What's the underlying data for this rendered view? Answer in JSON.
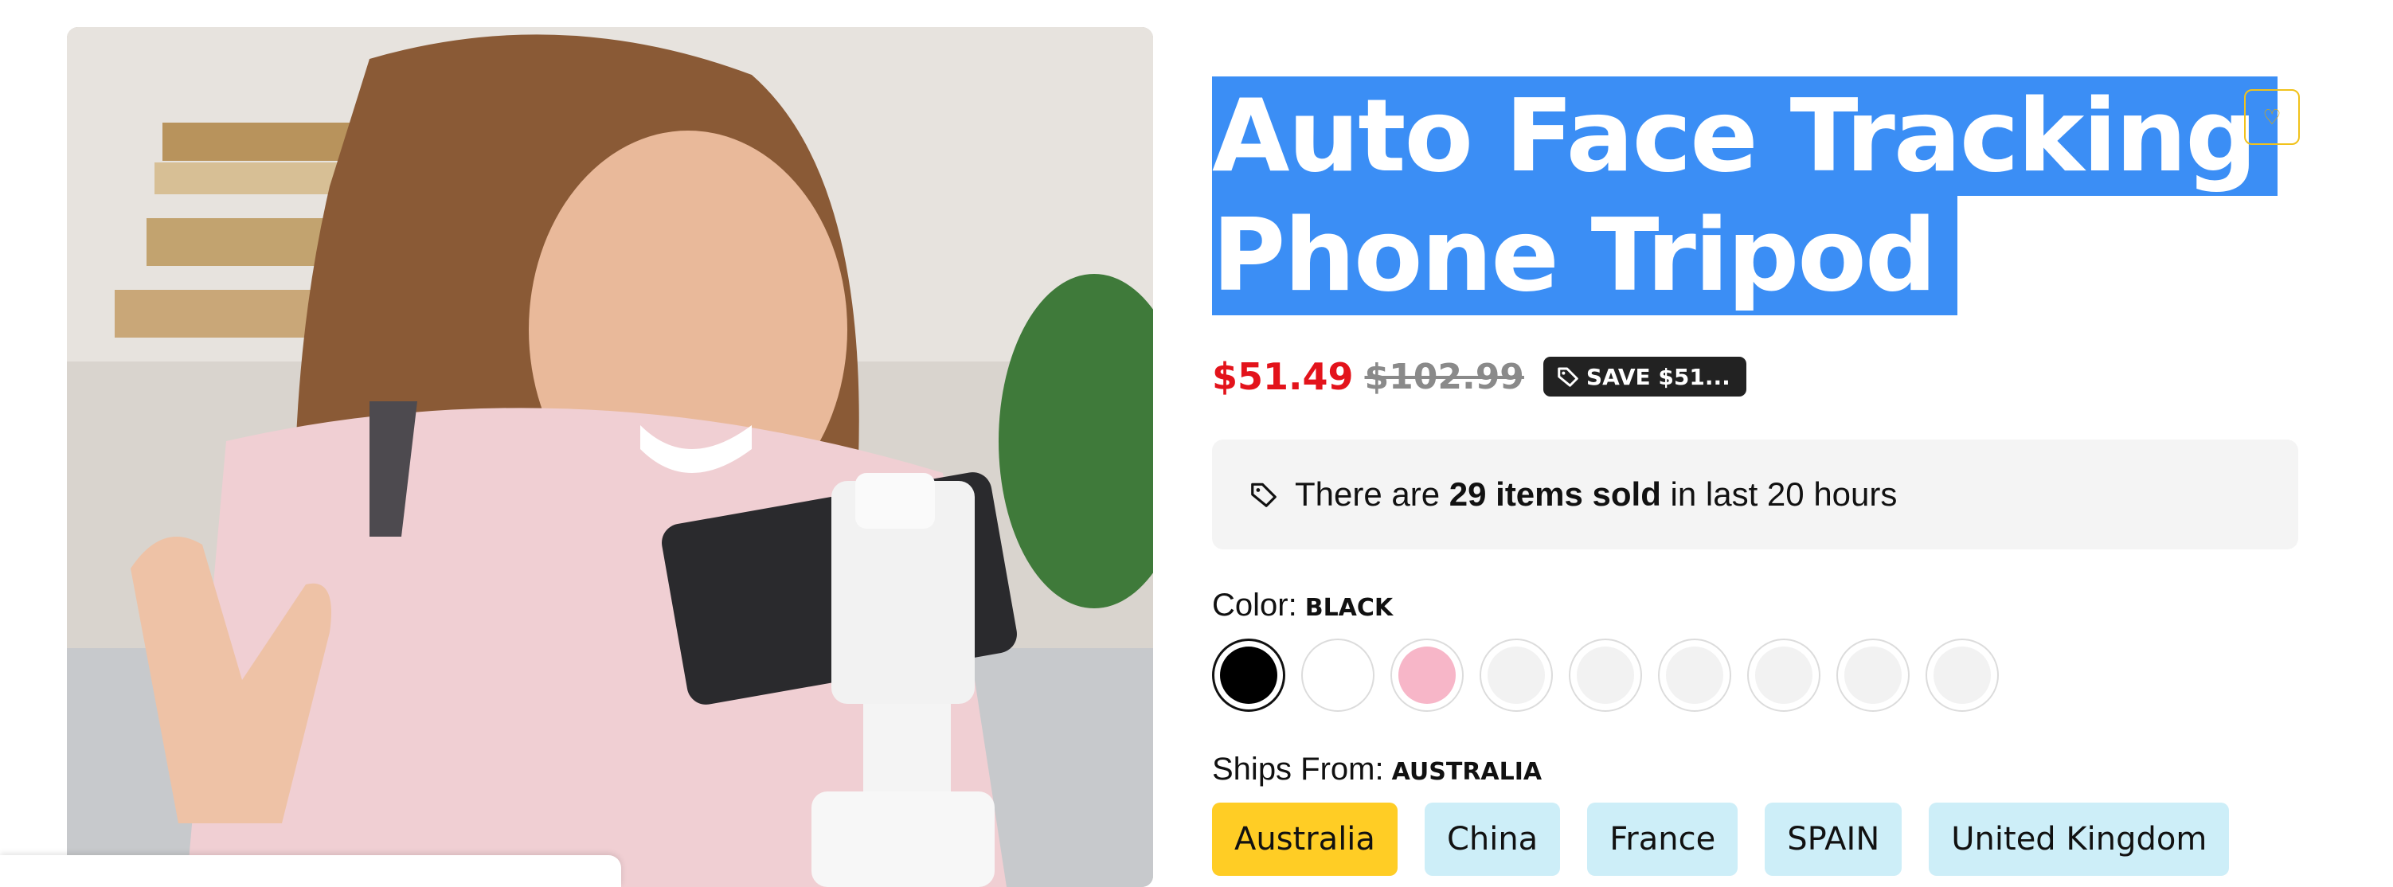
{
  "product": {
    "title_line1": "Auto Face Tracking",
    "title_line2": "Phone Tripod",
    "price_now": "$51.49",
    "price_old": "$102.99",
    "save_badge": "SAVE $51...",
    "image_icon": "product-photo-woman-with-phone-tripod"
  },
  "wishlist": {
    "icon": "heart-icon",
    "icon_glyph": "♡"
  },
  "sold": {
    "prefix": "There are",
    "count_text": "29 items sold",
    "suffix": "in last 20 hours"
  },
  "color": {
    "label": "Color:",
    "selected_value": "BLACK",
    "swatches": [
      {
        "color": "#000000",
        "selected": true
      },
      {
        "color": "#ffffff",
        "selected": false
      },
      {
        "color": "#f7b6c8",
        "selected": false
      },
      {
        "color": "#f2f2f2",
        "selected": false
      },
      {
        "color": "#f2f2f2",
        "selected": false
      },
      {
        "color": "#f2f2f2",
        "selected": false
      },
      {
        "color": "#f2f2f2",
        "selected": false
      },
      {
        "color": "#f2f2f2",
        "selected": false
      },
      {
        "color": "#f2f2f2",
        "selected": false
      }
    ]
  },
  "ships": {
    "label": "Ships From:",
    "selected_value": "AUSTRALIA",
    "options": [
      {
        "label": "Australia",
        "active": true
      },
      {
        "label": "China",
        "active": false
      },
      {
        "label": "France",
        "active": false
      },
      {
        "label": "SPAIN",
        "active": false
      },
      {
        "label": "United Kingdom",
        "active": false
      }
    ]
  },
  "colors": {
    "highlight": "#3b8ef5",
    "price_red": "#e3131b",
    "ship_active": "#ffcd25",
    "ship_inactive": "#cdeef8"
  }
}
